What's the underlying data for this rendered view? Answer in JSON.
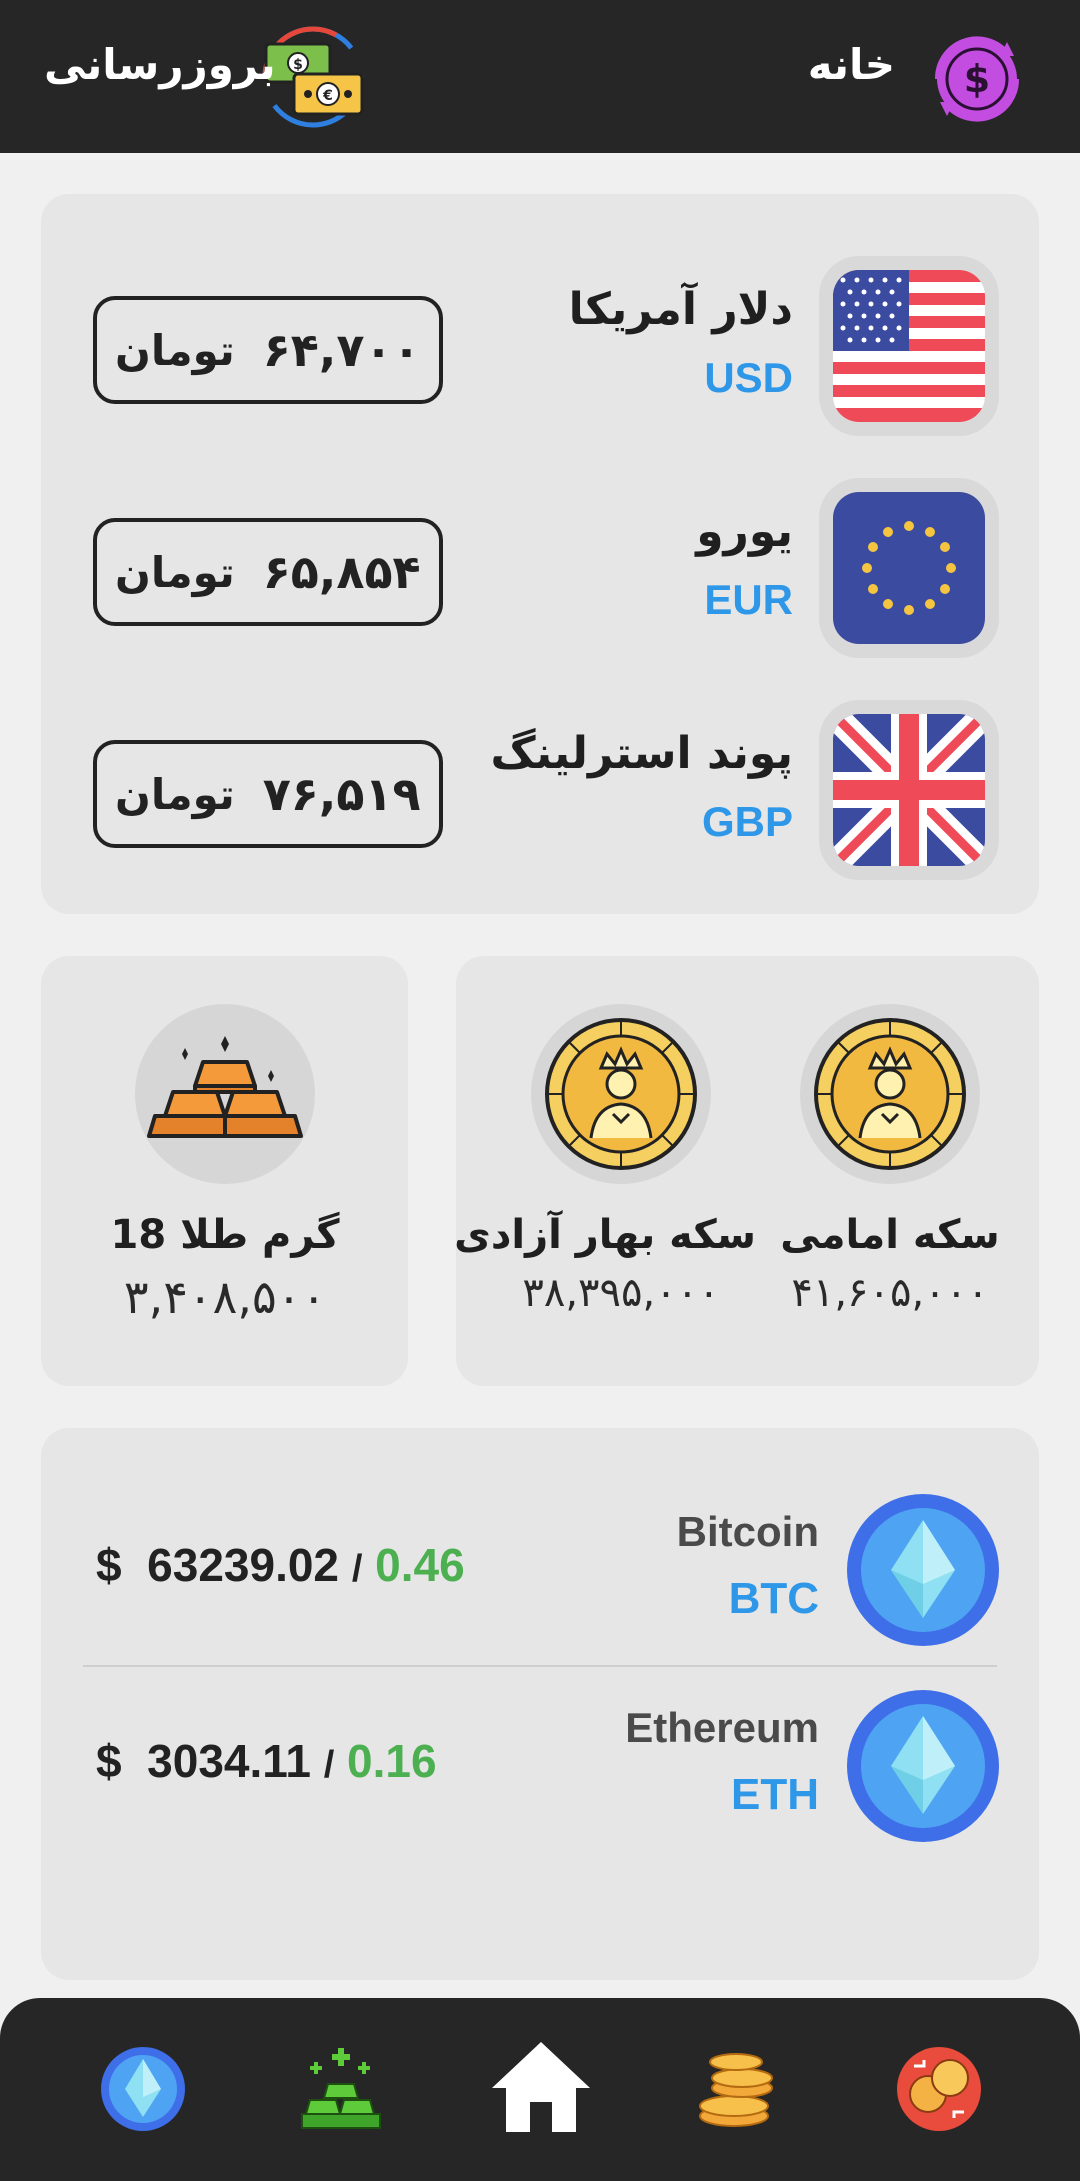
{
  "header": {
    "home_title": "خانه",
    "update_title": "بروزرسانی",
    "logo_icon": "dollar-cycle-icon",
    "update_icon": "currency-exchange-icon"
  },
  "currencies": [
    {
      "name": "دلار آمریکا",
      "code": "USD",
      "price": "۶۴,۷۰۰",
      "unit": "تومان",
      "icon": "us-flag-icon"
    },
    {
      "name": "یورو",
      "code": "EUR",
      "price": "۶۵,۸۵۴",
      "unit": "تومان",
      "icon": "eu-flag-icon"
    },
    {
      "name": "پوند استرلینگ",
      "code": "GBP",
      "price": "۷۶,۵۱۹",
      "unit": "تومان",
      "icon": "uk-flag-icon"
    }
  ],
  "coins": [
    {
      "name": "سکه امامی",
      "price": "۴۱,۶۰۵,۰۰۰",
      "icon": "gold-coin-icon"
    },
    {
      "name": "سکه بهار آزادی",
      "price": "۳۸,۳۹۵,۰۰۰",
      "icon": "gold-coin-icon"
    }
  ],
  "gold": {
    "name": "گرم طلا 18",
    "price": "۳,۴۰۸,۵۰۰",
    "icon": "gold-bars-icon"
  },
  "crypto": [
    {
      "name": "Bitcoin",
      "code": "BTC",
      "currency": "$",
      "price": "63239.02",
      "sep": "/",
      "change": "0.46",
      "icon": "diamond-crypto-icon"
    },
    {
      "name": "Ethereum",
      "code": "ETH",
      "currency": "$",
      "price": "3034.11",
      "sep": "/",
      "change": "0.16",
      "icon": "diamond-crypto-icon"
    }
  ],
  "colors": {
    "bar": "#262626",
    "card": "#e6e6e6",
    "code_blue": "#2f97e8",
    "change_green": "#4caf50"
  },
  "bottom_nav": [
    {
      "name": "crypto",
      "icon": "diamond-crypto-icon"
    },
    {
      "name": "gold",
      "icon": "gold-bars-green-icon"
    },
    {
      "name": "home",
      "icon": "home-icon"
    },
    {
      "name": "coins",
      "icon": "coin-stack-icon"
    },
    {
      "name": "exchange",
      "icon": "exchange-icon"
    }
  ]
}
